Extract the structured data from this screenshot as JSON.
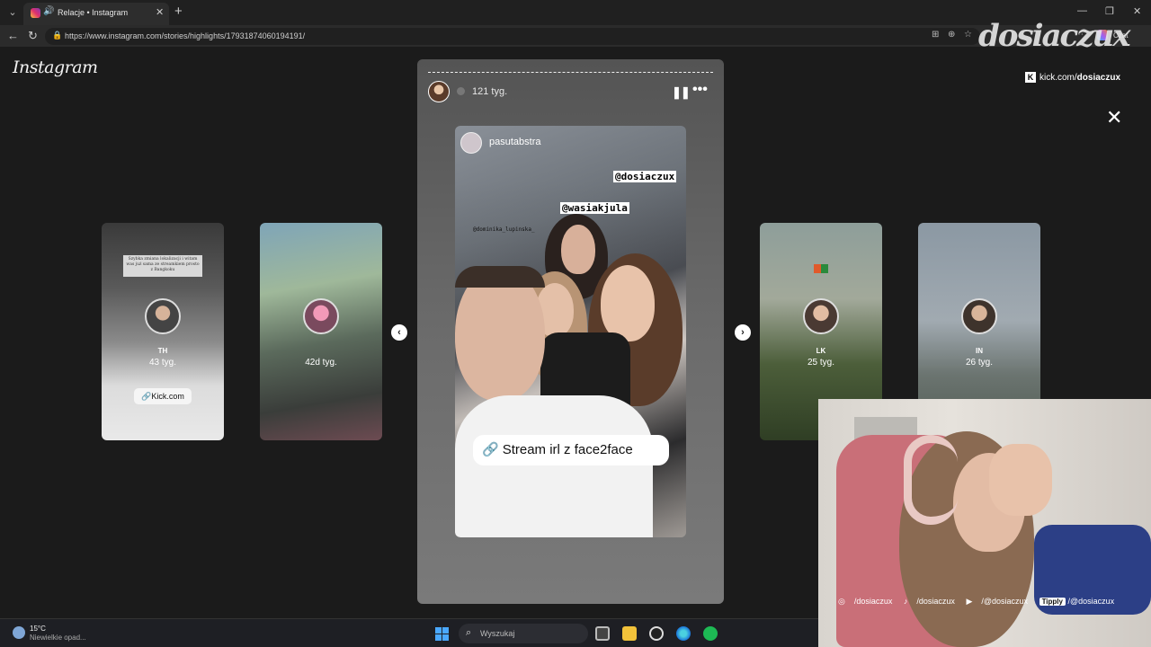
{
  "browser": {
    "tab_title": "Relacje • Instagram",
    "new_tab": "+",
    "url": "https://www.instagram.com/stories/highlights/17931874060194191/",
    "copilot_label": "Czat"
  },
  "instagram": {
    "logo": "Instagram",
    "left_cards": [
      {
        "name": "TH",
        "time": "43 tyg.",
        "caption": "Szybka zmiana lokalizacji i witam was już sama ze streamkiem prosto z Bangkoku",
        "link": "Kick.com"
      },
      {
        "name": "",
        "time": "42d tyg."
      }
    ],
    "right_cards": [
      {
        "name": "LK",
        "time": "25 tyg."
      },
      {
        "name": "IN",
        "time": "26 tyg."
      }
    ],
    "story": {
      "time": "121 tyg.",
      "photo_user": "pasutabstra",
      "mention_1": "@dosiaczux",
      "mention_2": "@wasiakjula",
      "mention_3": "@dominika_lupinska_",
      "link_text": "Stream irl z face2face"
    }
  },
  "overlay": {
    "logo": "dosiaczux",
    "kick_prefix": "kick.com/",
    "kick_handle": "dosiaczux",
    "socials": {
      "instagram": "/dosiaczux",
      "tiktok": "/dosiaczux",
      "youtube": "/@dosiaczux",
      "tipply_badge": "Tipply",
      "tipply": "/@dosiaczux"
    }
  },
  "taskbar": {
    "temp": "15°C",
    "weather": "Niewielkie opad...",
    "search_placeholder": "Wyszukaj"
  }
}
